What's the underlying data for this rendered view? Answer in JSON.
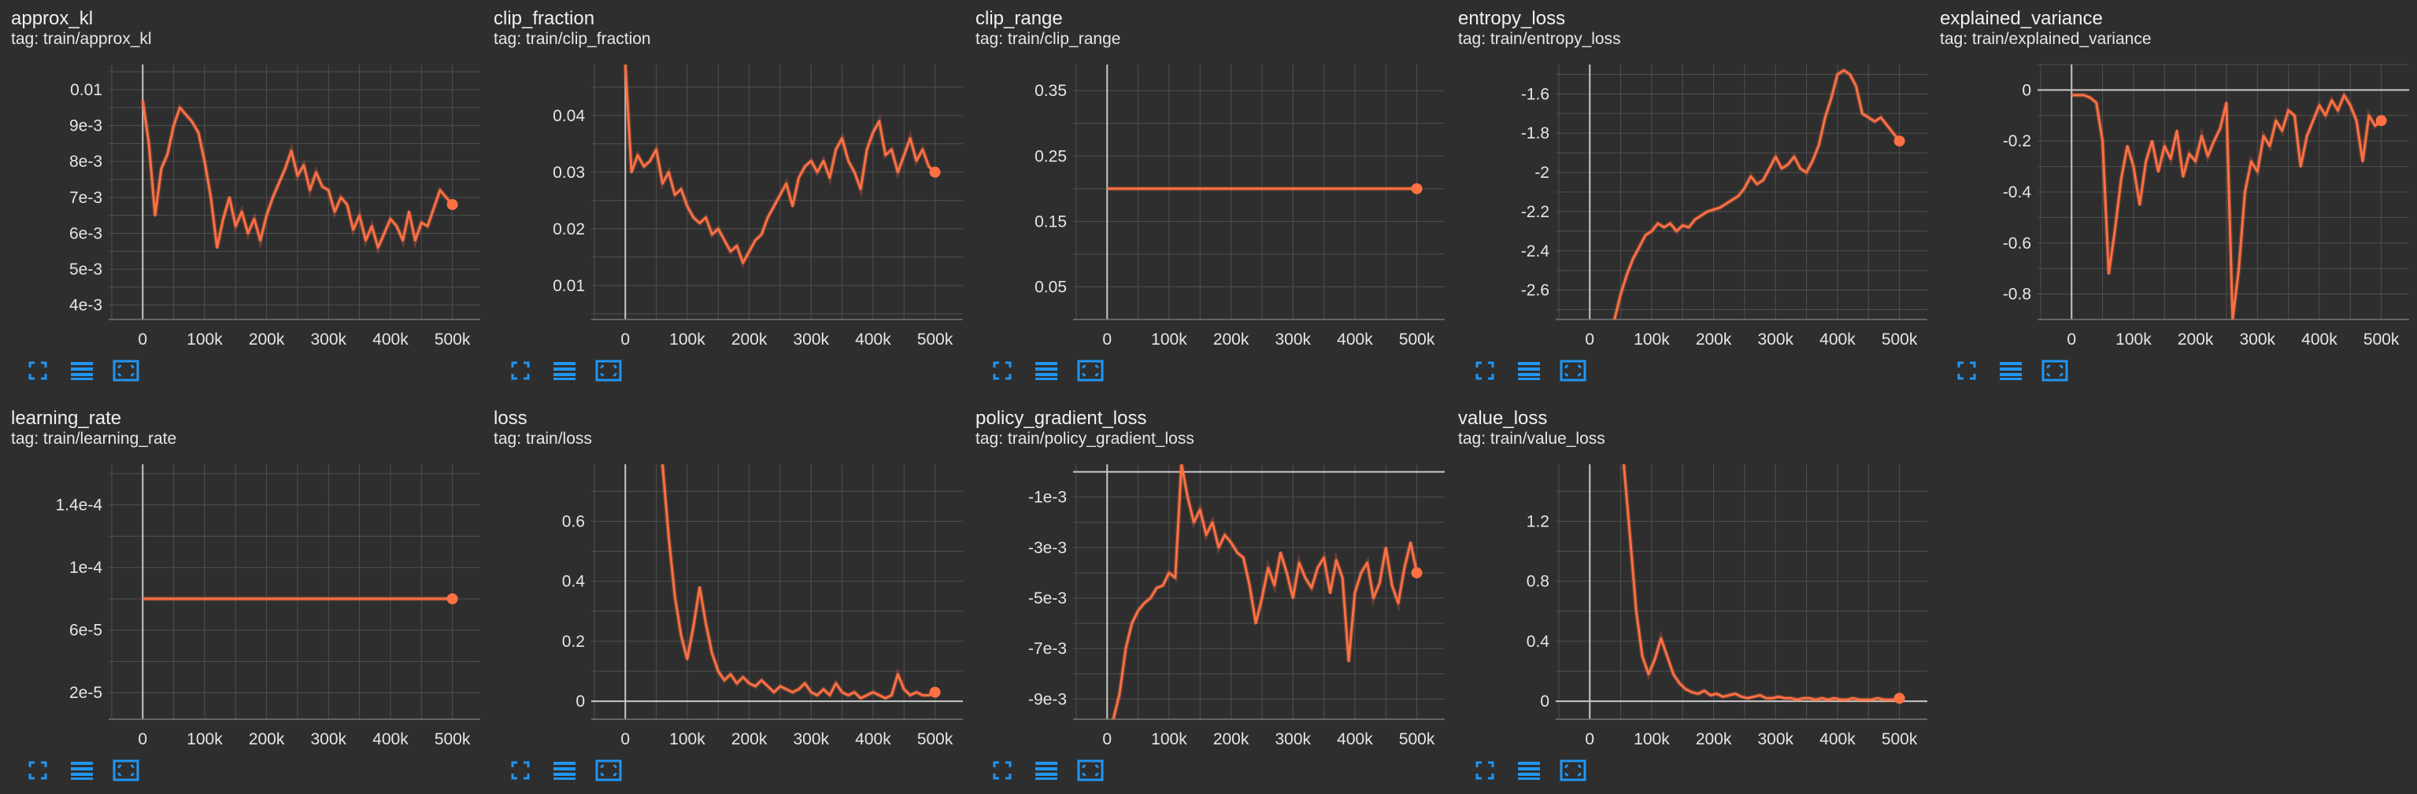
{
  "colors": {
    "accent": "#ff7043",
    "background": "#2e2e2e",
    "grid": "#505050",
    "button": "#2196f3"
  },
  "chart_controls": [
    "fullscreen-icon",
    "toggle-y-log-icon",
    "fit-domain-icon"
  ],
  "chart_data": [
    {
      "title": "approx_kl",
      "tag": "tag: train/approx_kl",
      "type": "line",
      "xlim": [
        -55000,
        545000
      ],
      "ylim": [
        0.0036,
        0.0107
      ],
      "xticks": [
        0,
        100000,
        200000,
        300000,
        400000,
        500000
      ],
      "xticklabels": [
        "0",
        "100k",
        "200k",
        "300k",
        "400k",
        "500k"
      ],
      "yticks": [
        0.004,
        0.005,
        0.006,
        0.007,
        0.008,
        0.009,
        0.01
      ],
      "yticklabels": [
        "4e-3",
        "5e-3",
        "6e-3",
        "7e-3",
        "8e-3",
        "9e-3",
        "0.01"
      ],
      "grid": true,
      "dot_last": true,
      "x": [
        0,
        10000,
        20000,
        30000,
        40000,
        50000,
        60000,
        70000,
        80000,
        90000,
        100000,
        110000,
        120000,
        130000,
        140000,
        150000,
        160000,
        170000,
        180000,
        190000,
        200000,
        210000,
        220000,
        230000,
        240000,
        250000,
        260000,
        270000,
        280000,
        290000,
        300000,
        310000,
        320000,
        330000,
        340000,
        350000,
        360000,
        370000,
        380000,
        390000,
        400000,
        410000,
        420000,
        430000,
        440000,
        450000,
        460000,
        470000,
        480000,
        490000,
        500000
      ],
      "values": [
        0.0097,
        0.0085,
        0.0065,
        0.0078,
        0.0082,
        0.009,
        0.0095,
        0.0093,
        0.0091,
        0.0088,
        0.008,
        0.007,
        0.0056,
        0.0064,
        0.007,
        0.0062,
        0.0066,
        0.006,
        0.0064,
        0.0058,
        0.0065,
        0.007,
        0.0074,
        0.0078,
        0.0083,
        0.0076,
        0.0079,
        0.0072,
        0.0077,
        0.0073,
        0.0072,
        0.0066,
        0.007,
        0.0068,
        0.0061,
        0.0065,
        0.0058,
        0.0062,
        0.0056,
        0.006,
        0.0064,
        0.0062,
        0.0058,
        0.0066,
        0.0058,
        0.0063,
        0.0062,
        0.0067,
        0.0072,
        0.007,
        0.0068
      ]
    },
    {
      "title": "clip_fraction",
      "tag": "tag: train/clip_fraction",
      "type": "line",
      "xlim": [
        -55000,
        545000
      ],
      "ylim": [
        0.004,
        0.049
      ],
      "xticks": [
        0,
        100000,
        200000,
        300000,
        400000,
        500000
      ],
      "xticklabels": [
        "0",
        "100k",
        "200k",
        "300k",
        "400k",
        "500k"
      ],
      "yticks": [
        0.01,
        0.02,
        0.03,
        0.04
      ],
      "yticklabels": [
        "0.01",
        "0.02",
        "0.03",
        "0.04"
      ],
      "grid": true,
      "dot_last": true,
      "x": [
        0,
        10000,
        20000,
        30000,
        40000,
        50000,
        60000,
        70000,
        80000,
        90000,
        100000,
        110000,
        120000,
        130000,
        140000,
        150000,
        160000,
        170000,
        180000,
        190000,
        200000,
        210000,
        220000,
        230000,
        240000,
        250000,
        260000,
        270000,
        280000,
        290000,
        300000,
        310000,
        320000,
        330000,
        340000,
        350000,
        360000,
        370000,
        380000,
        390000,
        400000,
        410000,
        420000,
        430000,
        440000,
        450000,
        460000,
        470000,
        480000,
        490000,
        500000
      ],
      "values": [
        0.049,
        0.03,
        0.033,
        0.031,
        0.032,
        0.034,
        0.028,
        0.03,
        0.026,
        0.027,
        0.024,
        0.022,
        0.021,
        0.022,
        0.019,
        0.02,
        0.018,
        0.016,
        0.017,
        0.014,
        0.016,
        0.018,
        0.019,
        0.022,
        0.024,
        0.026,
        0.028,
        0.024,
        0.029,
        0.031,
        0.032,
        0.03,
        0.032,
        0.029,
        0.034,
        0.036,
        0.032,
        0.03,
        0.027,
        0.034,
        0.037,
        0.039,
        0.033,
        0.034,
        0.03,
        0.033,
        0.036,
        0.032,
        0.034,
        0.031,
        0.03
      ]
    },
    {
      "title": "clip_range",
      "tag": "tag: train/clip_range",
      "type": "line",
      "xlim": [
        -55000,
        545000
      ],
      "ylim": [
        0,
        0.39
      ],
      "xticks": [
        0,
        100000,
        200000,
        300000,
        400000,
        500000
      ],
      "xticklabels": [
        "0",
        "100k",
        "200k",
        "300k",
        "400k",
        "500k"
      ],
      "yticks": [
        0.05,
        0.15,
        0.25,
        0.35
      ],
      "yticklabels": [
        "0.05",
        "0.15",
        "0.25",
        "0.35"
      ],
      "grid": true,
      "dot_last": true,
      "x": [
        0,
        500000
      ],
      "values": [
        0.2,
        0.2
      ]
    },
    {
      "title": "entropy_loss",
      "tag": "tag: train/entropy_loss",
      "type": "line",
      "xlim": [
        -55000,
        545000
      ],
      "ylim": [
        -2.75,
        -1.45
      ],
      "xticks": [
        0,
        100000,
        200000,
        300000,
        400000,
        500000
      ],
      "xticklabels": [
        "0",
        "100k",
        "200k",
        "300k",
        "400k",
        "500k"
      ],
      "yticks": [
        -2.6,
        -2.4,
        -2.2,
        -2.0,
        -1.8,
        -1.6
      ],
      "yticklabels": [
        "-2.6",
        "-2.4",
        "-2.2",
        "-2",
        "-1.8",
        "-1.6"
      ],
      "grid": true,
      "dot_last": true,
      "x": [
        40000,
        50000,
        60000,
        70000,
        80000,
        90000,
        100000,
        110000,
        120000,
        130000,
        140000,
        150000,
        160000,
        170000,
        180000,
        190000,
        200000,
        210000,
        220000,
        230000,
        240000,
        250000,
        260000,
        270000,
        280000,
        290000,
        300000,
        310000,
        320000,
        330000,
        340000,
        350000,
        360000,
        370000,
        380000,
        390000,
        400000,
        410000,
        420000,
        430000,
        440000,
        450000,
        460000,
        470000,
        480000,
        490000,
        500000
      ],
      "values": [
        -2.75,
        -2.62,
        -2.52,
        -2.44,
        -2.38,
        -2.32,
        -2.3,
        -2.26,
        -2.28,
        -2.26,
        -2.3,
        -2.27,
        -2.28,
        -2.24,
        -2.22,
        -2.2,
        -2.19,
        -2.18,
        -2.16,
        -2.14,
        -2.12,
        -2.08,
        -2.02,
        -2.06,
        -2.04,
        -1.98,
        -1.92,
        -1.98,
        -1.96,
        -1.92,
        -1.98,
        -2.0,
        -1.94,
        -1.86,
        -1.72,
        -1.62,
        -1.5,
        -1.48,
        -1.5,
        -1.56,
        -1.7,
        -1.72,
        -1.74,
        -1.72,
        -1.76,
        -1.8,
        -1.84
      ]
    },
    {
      "title": "explained_variance",
      "tag": "tag: train/explained_variance",
      "type": "line",
      "xlim": [
        -55000,
        545000
      ],
      "ylim": [
        -0.9,
        0.1
      ],
      "xticks": [
        0,
        100000,
        200000,
        300000,
        400000,
        500000
      ],
      "xticklabels": [
        "0",
        "100k",
        "200k",
        "300k",
        "400k",
        "500k"
      ],
      "yticks": [
        -0.8,
        -0.6,
        -0.4,
        -0.2,
        0
      ],
      "yticklabels": [
        "-0.8",
        "-0.6",
        "-0.4",
        "-0.2",
        "0"
      ],
      "grid": true,
      "dot_last": true,
      "x": [
        0,
        10000,
        20000,
        30000,
        40000,
        50000,
        60000,
        70000,
        80000,
        90000,
        100000,
        110000,
        120000,
        130000,
        140000,
        150000,
        160000,
        170000,
        180000,
        190000,
        200000,
        210000,
        220000,
        230000,
        240000,
        250000,
        260000,
        270000,
        280000,
        290000,
        300000,
        310000,
        320000,
        330000,
        340000,
        350000,
        360000,
        370000,
        380000,
        390000,
        400000,
        410000,
        420000,
        430000,
        440000,
        450000,
        460000,
        470000,
        480000,
        490000,
        500000
      ],
      "values": [
        -0.02,
        -0.02,
        -0.02,
        -0.03,
        -0.05,
        -0.2,
        -0.72,
        -0.55,
        -0.35,
        -0.22,
        -0.3,
        -0.45,
        -0.28,
        -0.2,
        -0.32,
        -0.22,
        -0.27,
        -0.16,
        -0.34,
        -0.25,
        -0.28,
        -0.18,
        -0.26,
        -0.2,
        -0.15,
        -0.05,
        -0.9,
        -0.7,
        -0.4,
        -0.28,
        -0.32,
        -0.18,
        -0.22,
        -0.12,
        -0.16,
        -0.08,
        -0.1,
        -0.3,
        -0.18,
        -0.12,
        -0.06,
        -0.1,
        -0.04,
        -0.08,
        -0.02,
        -0.06,
        -0.12,
        -0.28,
        -0.1,
        -0.14,
        -0.12
      ]
    },
    {
      "title": "learning_rate",
      "tag": "tag: train/learning_rate",
      "type": "line",
      "xlim": [
        -55000,
        545000
      ],
      "ylim": [
        3e-06,
        0.000166
      ],
      "xticks": [
        0,
        100000,
        200000,
        300000,
        400000,
        500000
      ],
      "xticklabels": [
        "0",
        "100k",
        "200k",
        "300k",
        "400k",
        "500k"
      ],
      "yticks": [
        2e-05,
        6e-05,
        0.0001,
        0.00014
      ],
      "yticklabels": [
        "2e-5",
        "6e-5",
        "1e-4",
        "1.4e-4"
      ],
      "grid": true,
      "dot_last": true,
      "x": [
        0,
        500000
      ],
      "values": [
        8e-05,
        8e-05
      ]
    },
    {
      "title": "loss",
      "tag": "tag: train/loss",
      "type": "line",
      "xlim": [
        -55000,
        545000
      ],
      "ylim": [
        -0.06,
        0.79
      ],
      "xticks": [
        0,
        100000,
        200000,
        300000,
        400000,
        500000
      ],
      "xticklabels": [
        "0",
        "100k",
        "200k",
        "300k",
        "400k",
        "500k"
      ],
      "yticks": [
        0,
        0.2,
        0.4,
        0.6
      ],
      "yticklabels": [
        "0",
        "0.2",
        "0.4",
        "0.6"
      ],
      "grid": true,
      "dot_last": true,
      "x": [
        60000,
        70000,
        80000,
        90000,
        100000,
        110000,
        120000,
        130000,
        140000,
        150000,
        160000,
        170000,
        180000,
        190000,
        200000,
        210000,
        220000,
        230000,
        240000,
        250000,
        260000,
        270000,
        280000,
        290000,
        300000,
        310000,
        320000,
        330000,
        340000,
        350000,
        360000,
        370000,
        380000,
        390000,
        400000,
        410000,
        420000,
        430000,
        440000,
        450000,
        460000,
        470000,
        480000,
        490000,
        500000
      ],
      "values": [
        0.79,
        0.55,
        0.35,
        0.22,
        0.14,
        0.25,
        0.38,
        0.26,
        0.16,
        0.1,
        0.07,
        0.09,
        0.06,
        0.08,
        0.06,
        0.05,
        0.07,
        0.05,
        0.03,
        0.05,
        0.04,
        0.03,
        0.04,
        0.06,
        0.03,
        0.02,
        0.04,
        0.02,
        0.06,
        0.03,
        0.02,
        0.03,
        0.01,
        0.02,
        0.03,
        0.02,
        0.01,
        0.02,
        0.09,
        0.04,
        0.02,
        0.03,
        0.02,
        0.02,
        0.03
      ]
    },
    {
      "title": "policy_gradient_loss",
      "tag": "tag: train/policy_gradient_loss",
      "type": "line",
      "xlim": [
        -55000,
        545000
      ],
      "ylim": [
        -0.0098,
        0.0003
      ],
      "xticks": [
        0,
        100000,
        200000,
        300000,
        400000,
        500000
      ],
      "xticklabels": [
        "0",
        "100k",
        "200k",
        "300k",
        "400k",
        "500k"
      ],
      "yticks": [
        -0.009,
        -0.007,
        -0.005,
        -0.003,
        -0.001
      ],
      "yticklabels": [
        "-9e-3",
        "-7e-3",
        "-5e-3",
        "-3e-3",
        "-1e-3"
      ],
      "grid": true,
      "dot_last": true,
      "x": [
        10000,
        20000,
        30000,
        40000,
        50000,
        60000,
        70000,
        80000,
        90000,
        100000,
        110000,
        120000,
        130000,
        140000,
        150000,
        160000,
        170000,
        180000,
        190000,
        200000,
        210000,
        220000,
        230000,
        240000,
        250000,
        260000,
        270000,
        280000,
        290000,
        300000,
        310000,
        320000,
        330000,
        340000,
        350000,
        360000,
        370000,
        380000,
        390000,
        400000,
        410000,
        420000,
        430000,
        440000,
        450000,
        460000,
        470000,
        480000,
        490000,
        500000
      ],
      "values": [
        -0.0098,
        -0.0088,
        -0.007,
        -0.006,
        -0.0055,
        -0.0052,
        -0.005,
        -0.0046,
        -0.0045,
        -0.004,
        -0.0042,
        0.0003,
        -0.001,
        -0.002,
        -0.0015,
        -0.0025,
        -0.002,
        -0.003,
        -0.0025,
        -0.0028,
        -0.0032,
        -0.0034,
        -0.0045,
        -0.006,
        -0.005,
        -0.0038,
        -0.0045,
        -0.0032,
        -0.004,
        -0.005,
        -0.0036,
        -0.0042,
        -0.0046,
        -0.0038,
        -0.0034,
        -0.0048,
        -0.0035,
        -0.0042,
        -0.0075,
        -0.0048,
        -0.004,
        -0.0036,
        -0.005,
        -0.0044,
        -0.003,
        -0.0045,
        -0.0052,
        -0.0038,
        -0.0028,
        -0.004
      ]
    },
    {
      "title": "value_loss",
      "tag": "tag: train/value_loss",
      "type": "line",
      "xlim": [
        -55000,
        545000
      ],
      "ylim": [
        -0.12,
        1.58
      ],
      "xticks": [
        0,
        100000,
        200000,
        300000,
        400000,
        500000
      ],
      "xticklabels": [
        "0",
        "100k",
        "200k",
        "300k",
        "400k",
        "500k"
      ],
      "yticks": [
        0,
        0.4,
        0.8,
        1.2
      ],
      "yticklabels": [
        "0",
        "0.4",
        "0.8",
        "1.2"
      ],
      "grid": true,
      "dot_last": true,
      "x": [
        55000,
        65000,
        75000,
        85000,
        95000,
        105000,
        115000,
        125000,
        135000,
        145000,
        155000,
        165000,
        175000,
        185000,
        195000,
        205000,
        215000,
        225000,
        235000,
        245000,
        255000,
        265000,
        275000,
        285000,
        295000,
        305000,
        315000,
        325000,
        335000,
        345000,
        355000,
        365000,
        375000,
        385000,
        395000,
        405000,
        415000,
        425000,
        435000,
        445000,
        455000,
        465000,
        475000,
        485000,
        495000,
        500000
      ],
      "values": [
        1.58,
        1.1,
        0.6,
        0.3,
        0.18,
        0.28,
        0.42,
        0.3,
        0.18,
        0.12,
        0.08,
        0.06,
        0.05,
        0.07,
        0.04,
        0.05,
        0.03,
        0.04,
        0.05,
        0.03,
        0.02,
        0.03,
        0.04,
        0.02,
        0.02,
        0.03,
        0.02,
        0.02,
        0.01,
        0.02,
        0.02,
        0.01,
        0.02,
        0.01,
        0.02,
        0.01,
        0.01,
        0.02,
        0.01,
        0.01,
        0.01,
        0.02,
        0.01,
        0.01,
        0.01,
        0.02
      ]
    }
  ]
}
